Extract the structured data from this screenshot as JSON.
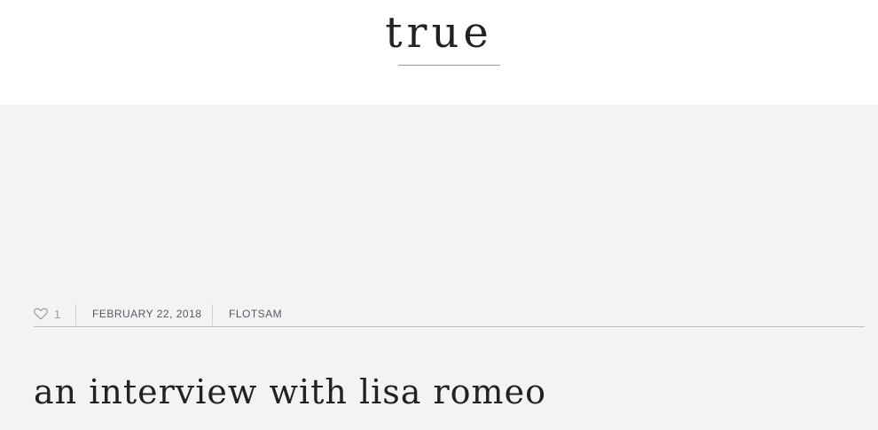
{
  "site": {
    "title": "true"
  },
  "post": {
    "likes": "1",
    "date": "FEBRUARY 22, 2018",
    "category": "FLOTSAM",
    "title": "an interview with lisa romeo"
  },
  "icons": {
    "like": "heart-outline-icon"
  },
  "colors": {
    "page_bg": "#ffffff",
    "content_bg": "#f3f3f3",
    "title_text": "#222222",
    "meta_text": "#555a63",
    "muted": "#9a9a9a",
    "rule": "#bdbdbd"
  }
}
